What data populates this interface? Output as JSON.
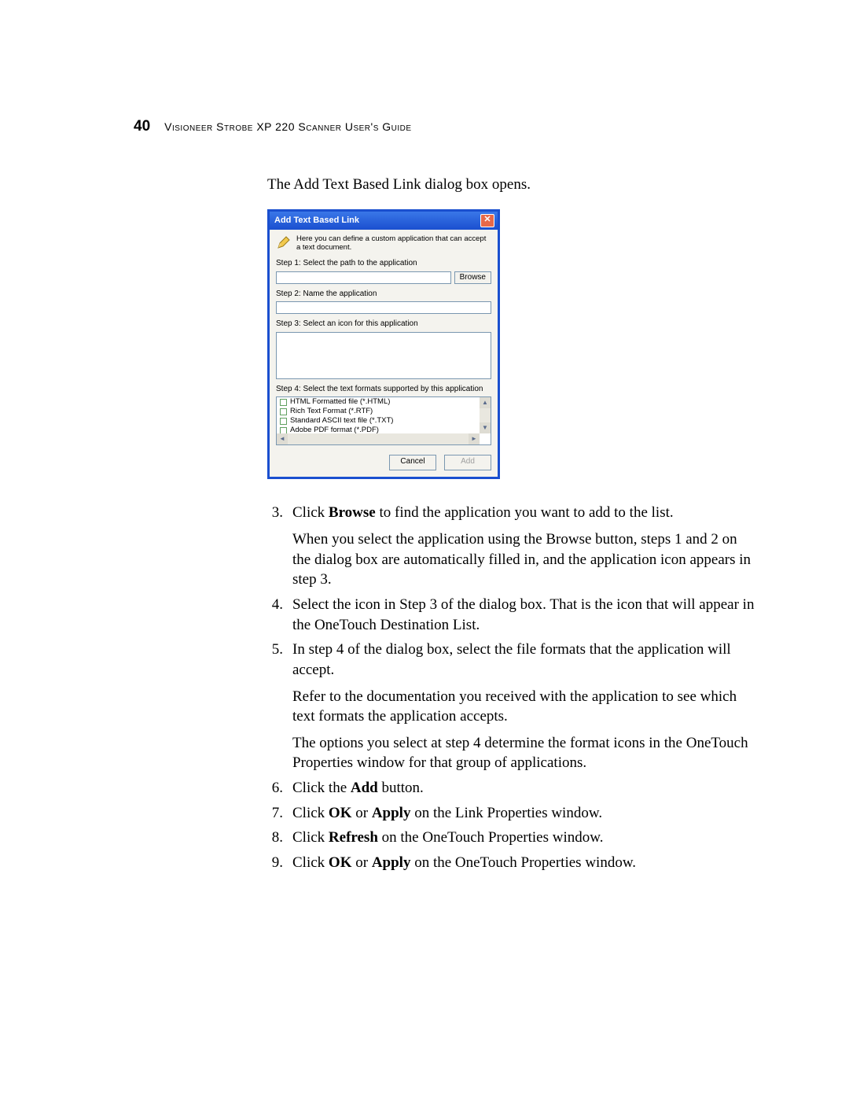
{
  "header": {
    "page_number": "40",
    "title": "Visioneer Strobe XP 220 Scanner User's Guide"
  },
  "intro": "The Add Text Based Link dialog box opens.",
  "dialog": {
    "title": "Add Text Based Link",
    "close_glyph": "✕",
    "info": "Here you can define a custom application that can accept a text document.",
    "step1_label": "Step 1: Select the path to the application",
    "browse_label": "Browse",
    "step2_label": "Step 2: Name the application",
    "step3_label": "Step 3: Select an icon for this application",
    "step4_label": "Step 4: Select the text formats supported by this application",
    "formats": [
      "HTML Formatted file (*.HTML)",
      "Rich Text Format (*.RTF)",
      "Standard ASCII text file (*.TXT)",
      "Adobe PDF format (*.PDF)"
    ],
    "cancel_label": "Cancel",
    "add_label": "Add"
  },
  "steps": {
    "s3": {
      "num": "3.",
      "p1_a": "Click ",
      "p1_bold": "Browse",
      "p1_b": " to find the application you want to add to the list.",
      "p2": "When you select the application using the Browse button, steps 1 and 2 on the dialog box are automatically filled in, and the application icon appears in step 3."
    },
    "s4": {
      "num": "4.",
      "p1": "Select the icon in Step 3 of the dialog box. That is the icon that will appear in the OneTouch Destination List."
    },
    "s5": {
      "num": "5.",
      "p1": "In step 4 of the dialog box, select the file formats that the application will accept.",
      "p2": "Refer to the documentation you received with the application to see which text formats the application accepts.",
      "p3": "The options you select at step 4 determine the format icons in the OneTouch Properties window for that group of applications."
    },
    "s6": {
      "num": "6.",
      "p1_a": "Click the ",
      "p1_bold": "Add",
      "p1_b": " button."
    },
    "s7": {
      "num": "7.",
      "p1_a": "Click ",
      "p1_bold1": "OK",
      "p1_mid": " or ",
      "p1_bold2": "Apply",
      "p1_b": " on the Link Properties window."
    },
    "s8": {
      "num": "8.",
      "p1_a": "Click ",
      "p1_bold": "Refresh",
      "p1_b": " on the OneTouch Properties window."
    },
    "s9": {
      "num": "9.",
      "p1_a": "Click ",
      "p1_bold1": "OK",
      "p1_mid": " or ",
      "p1_bold2": "Apply",
      "p1_b": " on the OneTouch Properties window."
    }
  }
}
